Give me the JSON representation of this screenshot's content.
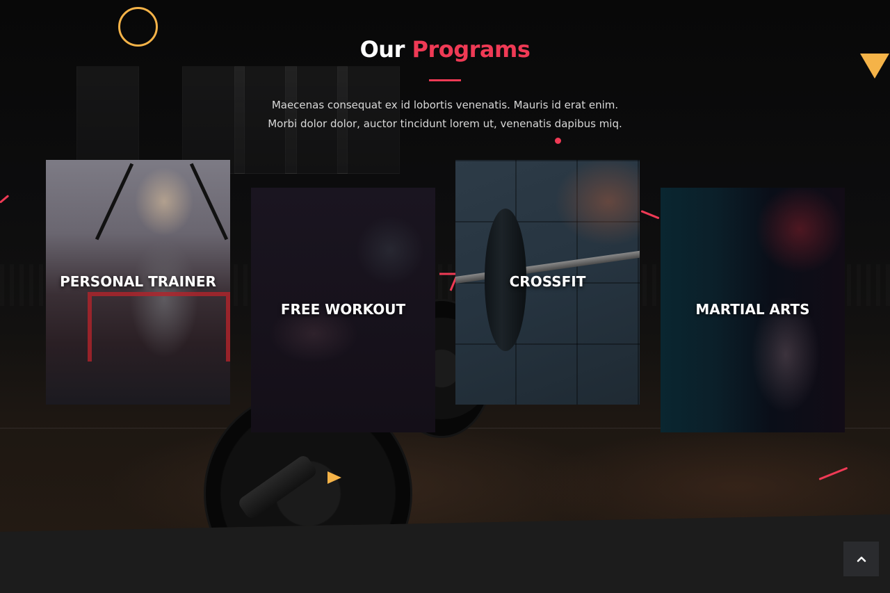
{
  "section": {
    "title_plain": "Our ",
    "title_accent": "Programs",
    "subtitle_line1": "Maecenas consequat ex id lobortis venenatis. Mauris id erat enim.",
    "subtitle_line2": "Morbi dolor dolor, auctor tincidunt lorem ut, venenatis dapibus miq."
  },
  "programs": [
    {
      "label": "PERSONAL TRAINER"
    },
    {
      "label": "FREE WORKOUT"
    },
    {
      "label": "CROSSFIT"
    },
    {
      "label": "MARTIAL ARTS"
    }
  ],
  "colors": {
    "accent_red": "#ef3a55",
    "accent_yellow": "#f5b348",
    "background": "#1c1c1c"
  },
  "icons": {
    "back_to_top": "chevron-up-icon"
  }
}
